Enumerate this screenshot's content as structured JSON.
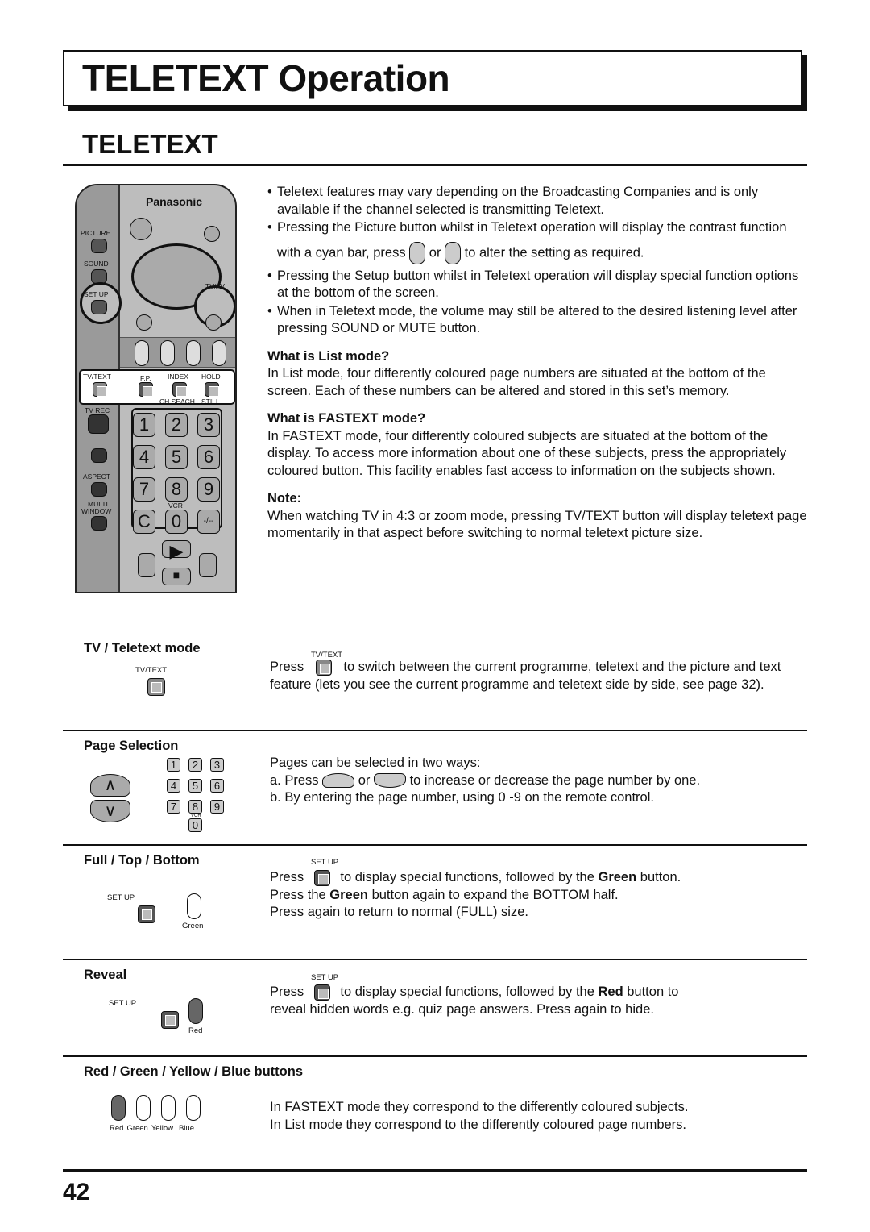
{
  "header": {
    "title": "TELETEXT Operation",
    "section": "TELETEXT"
  },
  "remote": {
    "brand": "Panasonic",
    "labels": {
      "picture": "PICTURE",
      "sound": "SOUND",
      "setup": "SET UP",
      "tvav": "TV/AV",
      "tvtext": "TV/TEXT",
      "fp": "F.P.",
      "index": "INDEX",
      "hold": "HOLD",
      "chsearch": "CH SEACH",
      "still": "STILL",
      "tvrec": "TV REC",
      "aspect": "ASPECT",
      "multi": "MULTI",
      "window": "WINDOW",
      "vcr": "VCR"
    },
    "keys": [
      "1",
      "2",
      "3",
      "4",
      "5",
      "6",
      "7",
      "8",
      "9",
      "C",
      "0",
      "-/--"
    ]
  },
  "intro": {
    "bullets": [
      "Teletext features may vary depending on the Broadcasting Companies and is only available if the channel selected is transmitting Teletext.",
      "Pressing the Picture button whilst in Teletext operation will display the contrast function",
      "Pressing the Setup button whilst in Teletext operation will display special function options at the bottom of the screen.",
      "When in Teletext mode, the volume may still be altered to the desired listening level after pressing SOUND or MUTE button."
    ],
    "cyan_a": "with a cyan bar, press",
    "cyan_or": "or",
    "cyan_b": "to alter the setting as required."
  },
  "list_mode": {
    "heading": "What is List mode?",
    "text": "In List mode, four differently coloured page numbers are situated at the bottom of the screen. Each of these numbers can be altered and stored in this set’s memory."
  },
  "fastext_mode": {
    "heading": "What is FASTEXT mode?",
    "text": "In FASTEXT mode, four differently coloured subjects are situated at the bottom of the display. To access more information about one of these subjects, press the appropriately coloured button. This facility enables fast access to information on the subjects shown."
  },
  "note": {
    "heading": "Note:",
    "text": "When watching TV in 4:3 or zoom mode, pressing TV/TEXT button will display teletext page momentarily in that aspect before switching to normal teletext picture size."
  },
  "sections": {
    "tv_teletext": {
      "title": "TV / Teletext mode",
      "icon_label": "TV/TEXT",
      "press": "Press",
      "text": "to switch between the current programme, teletext and the picture and text feature (lets you see the current programme and teletext side by side, see page 32)."
    },
    "page_selection": {
      "title": "Page Selection",
      "line1": "Pages can be selected in two ways:",
      "a1": "a. Press",
      "a_or": "or",
      "a2": "to increase or decrease the page number by one.",
      "b": "b. By entering the page number, using 0 -9 on the remote control.",
      "vcr": "VCR"
    },
    "full_top_bottom": {
      "title": "Full / Top / Bottom",
      "icon_label": "SET UP",
      "green_label": "Green",
      "press": "Press",
      "l1b": "to display special functions, followed by the",
      "green": "Green",
      "l1c": "button.",
      "l2a": "Press the",
      "l2c": "button again to expand the BOTTOM half.",
      "l3": "Press again to return to normal (FULL) size."
    },
    "reveal": {
      "title": "Reveal",
      "icon_label": "SET UP",
      "red_label": "Red",
      "press": "Press",
      "l1b": "to display special functions, followed by the",
      "red": "Red",
      "l1c": "button to",
      "l2": "reveal hidden words e.g. quiz page answers. Press again to hide."
    },
    "colour_buttons": {
      "title": "Red / Green / Yellow / Blue buttons",
      "labels": [
        "Red",
        "Green",
        "Yellow",
        "Blue"
      ],
      "l1": "In FASTEXT mode they correspond to the differently coloured subjects.",
      "l2": "In List mode they correspond to the differently coloured page numbers."
    }
  },
  "page_number": "42"
}
